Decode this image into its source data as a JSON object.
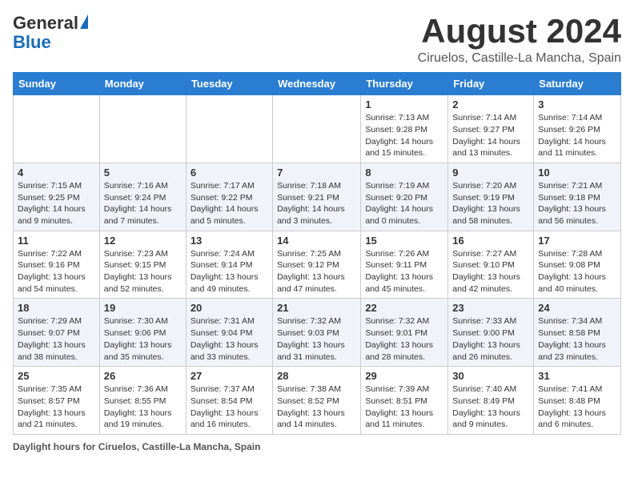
{
  "header": {
    "logo_general": "General",
    "logo_blue": "Blue",
    "month_year": "August 2024",
    "location": "Ciruelos, Castille-La Mancha, Spain"
  },
  "calendar": {
    "days_of_week": [
      "Sunday",
      "Monday",
      "Tuesday",
      "Wednesday",
      "Thursday",
      "Friday",
      "Saturday"
    ],
    "weeks": [
      [
        {
          "day": "",
          "info": ""
        },
        {
          "day": "",
          "info": ""
        },
        {
          "day": "",
          "info": ""
        },
        {
          "day": "",
          "info": ""
        },
        {
          "day": "1",
          "info": "Sunrise: 7:13 AM\nSunset: 9:28 PM\nDaylight: 14 hours and 15 minutes."
        },
        {
          "day": "2",
          "info": "Sunrise: 7:14 AM\nSunset: 9:27 PM\nDaylight: 14 hours and 13 minutes."
        },
        {
          "day": "3",
          "info": "Sunrise: 7:14 AM\nSunset: 9:26 PM\nDaylight: 14 hours and 11 minutes."
        }
      ],
      [
        {
          "day": "4",
          "info": "Sunrise: 7:15 AM\nSunset: 9:25 PM\nDaylight: 14 hours and 9 minutes."
        },
        {
          "day": "5",
          "info": "Sunrise: 7:16 AM\nSunset: 9:24 PM\nDaylight: 14 hours and 7 minutes."
        },
        {
          "day": "6",
          "info": "Sunrise: 7:17 AM\nSunset: 9:22 PM\nDaylight: 14 hours and 5 minutes."
        },
        {
          "day": "7",
          "info": "Sunrise: 7:18 AM\nSunset: 9:21 PM\nDaylight: 14 hours and 3 minutes."
        },
        {
          "day": "8",
          "info": "Sunrise: 7:19 AM\nSunset: 9:20 PM\nDaylight: 14 hours and 0 minutes."
        },
        {
          "day": "9",
          "info": "Sunrise: 7:20 AM\nSunset: 9:19 PM\nDaylight: 13 hours and 58 minutes."
        },
        {
          "day": "10",
          "info": "Sunrise: 7:21 AM\nSunset: 9:18 PM\nDaylight: 13 hours and 56 minutes."
        }
      ],
      [
        {
          "day": "11",
          "info": "Sunrise: 7:22 AM\nSunset: 9:16 PM\nDaylight: 13 hours and 54 minutes."
        },
        {
          "day": "12",
          "info": "Sunrise: 7:23 AM\nSunset: 9:15 PM\nDaylight: 13 hours and 52 minutes."
        },
        {
          "day": "13",
          "info": "Sunrise: 7:24 AM\nSunset: 9:14 PM\nDaylight: 13 hours and 49 minutes."
        },
        {
          "day": "14",
          "info": "Sunrise: 7:25 AM\nSunset: 9:12 PM\nDaylight: 13 hours and 47 minutes."
        },
        {
          "day": "15",
          "info": "Sunrise: 7:26 AM\nSunset: 9:11 PM\nDaylight: 13 hours and 45 minutes."
        },
        {
          "day": "16",
          "info": "Sunrise: 7:27 AM\nSunset: 9:10 PM\nDaylight: 13 hours and 42 minutes."
        },
        {
          "day": "17",
          "info": "Sunrise: 7:28 AM\nSunset: 9:08 PM\nDaylight: 13 hours and 40 minutes."
        }
      ],
      [
        {
          "day": "18",
          "info": "Sunrise: 7:29 AM\nSunset: 9:07 PM\nDaylight: 13 hours and 38 minutes."
        },
        {
          "day": "19",
          "info": "Sunrise: 7:30 AM\nSunset: 9:06 PM\nDaylight: 13 hours and 35 minutes."
        },
        {
          "day": "20",
          "info": "Sunrise: 7:31 AM\nSunset: 9:04 PM\nDaylight: 13 hours and 33 minutes."
        },
        {
          "day": "21",
          "info": "Sunrise: 7:32 AM\nSunset: 9:03 PM\nDaylight: 13 hours and 31 minutes."
        },
        {
          "day": "22",
          "info": "Sunrise: 7:32 AM\nSunset: 9:01 PM\nDaylight: 13 hours and 28 minutes."
        },
        {
          "day": "23",
          "info": "Sunrise: 7:33 AM\nSunset: 9:00 PM\nDaylight: 13 hours and 26 minutes."
        },
        {
          "day": "24",
          "info": "Sunrise: 7:34 AM\nSunset: 8:58 PM\nDaylight: 13 hours and 23 minutes."
        }
      ],
      [
        {
          "day": "25",
          "info": "Sunrise: 7:35 AM\nSunset: 8:57 PM\nDaylight: 13 hours and 21 minutes."
        },
        {
          "day": "26",
          "info": "Sunrise: 7:36 AM\nSunset: 8:55 PM\nDaylight: 13 hours and 19 minutes."
        },
        {
          "day": "27",
          "info": "Sunrise: 7:37 AM\nSunset: 8:54 PM\nDaylight: 13 hours and 16 minutes."
        },
        {
          "day": "28",
          "info": "Sunrise: 7:38 AM\nSunset: 8:52 PM\nDaylight: 13 hours and 14 minutes."
        },
        {
          "day": "29",
          "info": "Sunrise: 7:39 AM\nSunset: 8:51 PM\nDaylight: 13 hours and 11 minutes."
        },
        {
          "day": "30",
          "info": "Sunrise: 7:40 AM\nSunset: 8:49 PM\nDaylight: 13 hours and 9 minutes."
        },
        {
          "day": "31",
          "info": "Sunrise: 7:41 AM\nSunset: 8:48 PM\nDaylight: 13 hours and 6 minutes."
        }
      ]
    ]
  },
  "footer": {
    "label": "Daylight hours",
    "description": "for Ciruelos, Castille-La Mancha, Spain"
  }
}
